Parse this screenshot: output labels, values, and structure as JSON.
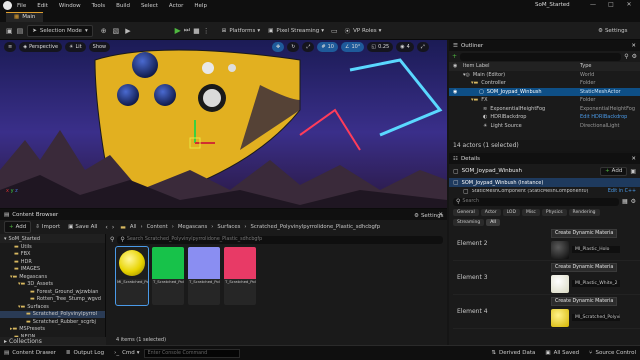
{
  "app": {
    "window_title": "SoM_Started",
    "menus": [
      "File",
      "Edit",
      "Window",
      "Tools",
      "Build",
      "Select",
      "Actor",
      "Help"
    ],
    "doc_tab": "Main"
  },
  "toolbar": {
    "selection_mode": "Selection Mode",
    "platforms": "Platforms",
    "pixel_streaming": "Pixel Streaming",
    "vp_roles": "VP Roles",
    "settings": "Settings"
  },
  "viewport": {
    "perspective": "Perspective",
    "lit": "Lit",
    "show": "Show",
    "grid_snap": "10",
    "angle_snap": "10°",
    "scale_snap": "0.25",
    "camera_speed": "4"
  },
  "outliner": {
    "title": "Outliner",
    "col_label": "Item Label",
    "col_type": "Type",
    "rows": [
      {
        "label": "Main (Editor)",
        "type": "World",
        "indent": 1
      },
      {
        "label": "Controller",
        "type": "Folder",
        "indent": 2
      },
      {
        "label": "SOM_Joypad_Winbush",
        "type": "StaticMeshActor",
        "indent": 3
      },
      {
        "label": "FX",
        "type": "Folder",
        "indent": 2
      },
      {
        "label": "ExponentialHeightFog",
        "type": "ExponentialHeightFog",
        "indent": 3
      },
      {
        "label": "HDRIBackdrop",
        "type": "Edit HDRIBackdrop",
        "indent": 3
      },
      {
        "label": "Light Source",
        "type": "DirectionalLight",
        "indent": 3
      }
    ],
    "footer": "14 actors (1 selected)"
  },
  "details": {
    "title": "Details",
    "actor_name": "SOM_Joypad_Winbush",
    "add_label": "Add",
    "instance": "SOM_Joypad_Winbush (Instance)",
    "component": "StaticMeshComponent (StaticMeshComponent0)",
    "edit_cpp": "Edit in C++",
    "search_placeholder": "Search",
    "filters": [
      "General",
      "Actor",
      "LOD",
      "Misc",
      "Physics",
      "Rendering",
      "Streaming",
      "All"
    ],
    "elements": [
      {
        "label": "Element 2",
        "button": "Create Dynamic Materia",
        "material": "MI_Plastic_Holo"
      },
      {
        "label": "Element 3",
        "button": "Create Dynamic Materia",
        "material": "MI_Plastic_White_2"
      },
      {
        "label": "Element 4",
        "button": "Create Dynamic Materia",
        "material": "MI_Scratched_Polyvi"
      }
    ]
  },
  "content_browser": {
    "title": "Content Browser",
    "add": "Add",
    "import": "Import",
    "save_all": "Save All",
    "breadcrumb": [
      "All",
      "Content",
      "Megascans",
      "Surfaces",
      "Scratched_Polyvinylpyrrolidone_Plastic_sdhcbgfp"
    ],
    "settings": "Settings",
    "search_placeholder": "Search Scratched_Polyvinylpyrrolidone_Plastic_sdhcbgfp",
    "root": "SoM_Started",
    "tree": [
      {
        "label": "Utils",
        "indent": 1
      },
      {
        "label": "FBX",
        "indent": 1
      },
      {
        "label": "HDR",
        "indent": 1
      },
      {
        "label": "IMAGES",
        "indent": 1
      },
      {
        "label": "Megascans",
        "indent": 1
      },
      {
        "label": "3D_Assets",
        "indent": 2
      },
      {
        "label": "Forest_Ground_wjzwbian",
        "indent": 3
      },
      {
        "label": "Rotten_Tree_Stump_wgvd",
        "indent": 3
      },
      {
        "label": "Surfaces",
        "indent": 2
      },
      {
        "label": "Scratched_Polyvinylpyrrol",
        "indent": 3
      },
      {
        "label": "Scratched_Rubber_scgrbj",
        "indent": 3
      },
      {
        "label": "MSPresets",
        "indent": 1
      },
      {
        "label": "NEON",
        "indent": 1
      }
    ],
    "collections": "Collections",
    "assets": [
      {
        "label": "MI_Scratched_Polyvinylpyrrol...",
        "color": "#e8d400"
      },
      {
        "label": "T_Scratched_Polyvinylpyrrol..._Plastic...",
        "color": "#17c24a"
      },
      {
        "label": "T_Scratched_Polyvinylpyrrol..._Plastic...",
        "color": "#8a8ef2"
      },
      {
        "label": "T_Scratched_Polyvinylpyrrol..._Plastic...",
        "color": "#e83a66"
      }
    ],
    "footer": "4 items (1 selected)"
  },
  "status_bar": {
    "content_drawer": "Content Drawer",
    "output_log": "Output Log",
    "cmd": "Cmd",
    "console_placeholder": "Enter Console Command",
    "derived_data": "Derived Data",
    "all_saved": "All Saved",
    "source_control": "Source Control"
  },
  "colors": {
    "accent_blue": "#0e4f86",
    "play_green": "#4fb840",
    "tab_accent": "#e0a030"
  }
}
